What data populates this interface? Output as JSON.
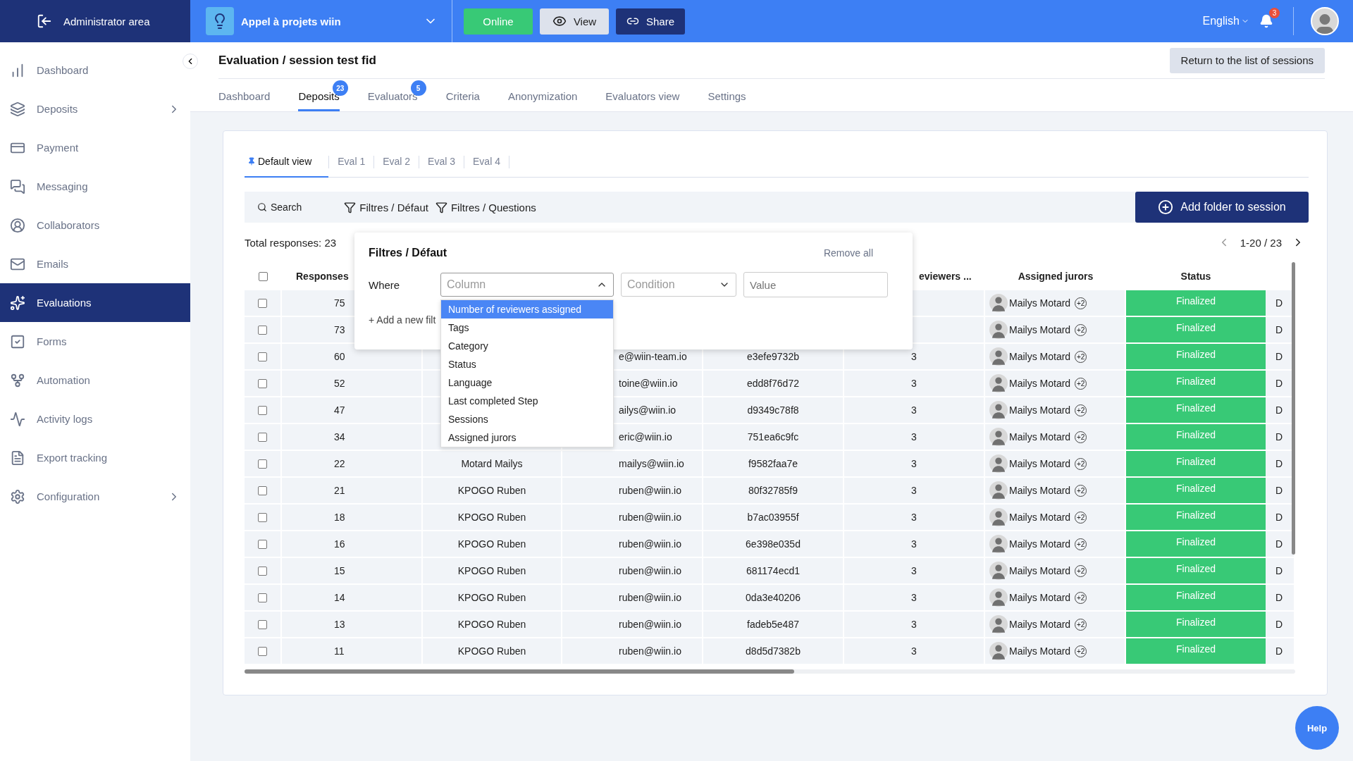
{
  "topbar": {
    "admin_label": "Administrator area",
    "project": "Appel à projets wiin",
    "online": "Online",
    "view": "View",
    "share": "Share",
    "language": "English",
    "notifications": "3"
  },
  "sidebar": {
    "items": [
      {
        "label": "Dashboard",
        "selected": false,
        "has_submenu": false
      },
      {
        "label": "Deposits",
        "selected": false,
        "has_submenu": true
      },
      {
        "label": "Payment",
        "selected": false,
        "has_submenu": false
      },
      {
        "label": "Messaging",
        "selected": false,
        "has_submenu": false
      },
      {
        "label": "Collaborators",
        "selected": false,
        "has_submenu": false
      },
      {
        "label": "Emails",
        "selected": false,
        "has_submenu": false
      },
      {
        "label": "Evaluations",
        "selected": true,
        "has_submenu": false
      },
      {
        "label": "Forms",
        "selected": false,
        "has_submenu": false
      },
      {
        "label": "Automation",
        "selected": false,
        "has_submenu": false
      },
      {
        "label": "Activity logs",
        "selected": false,
        "has_submenu": false
      },
      {
        "label": "Export tracking",
        "selected": false,
        "has_submenu": false
      },
      {
        "label": "Configuration",
        "selected": false,
        "has_submenu": true
      }
    ]
  },
  "header": {
    "title": "Evaluation / session test fid",
    "back_button": "Return to the list of sessions",
    "tabs": [
      {
        "label": "Dashboard",
        "selected": false
      },
      {
        "label": "Deposits",
        "selected": true,
        "badge": "23"
      },
      {
        "label": "Evaluators",
        "selected": false,
        "badge": "5"
      },
      {
        "label": "Criteria",
        "selected": false
      },
      {
        "label": "Anonymization",
        "selected": false
      },
      {
        "label": "Evaluators view",
        "selected": false
      },
      {
        "label": "Settings",
        "selected": false
      }
    ]
  },
  "view_tabs": [
    {
      "label": "Default view",
      "selected": true
    },
    {
      "label": "Eval 1",
      "selected": false
    },
    {
      "label": "Eval 2",
      "selected": false
    },
    {
      "label": "Eval 3",
      "selected": false
    },
    {
      "label": "Eval 4",
      "selected": false
    }
  ],
  "toolbar": {
    "search": "Search",
    "filters": [
      "Filtres / Défaut",
      "Filtres / Questions"
    ],
    "add_button": "Add folder to session"
  },
  "total": "Total responses: 23",
  "pagination": "1-20 / 23",
  "table": {
    "header_checked": false,
    "columns": [
      "Responses",
      null,
      null,
      null,
      "eviewers ...",
      "Assigned jurors",
      "Status",
      null
    ],
    "rows": [
      {
        "checked": false,
        "cells": [
          "75",
          null,
          null,
          null,
          null,
          "Mailys Motard",
          "Finalized",
          "D"
        ],
        "extra": "+2"
      },
      {
        "checked": false,
        "cells": [
          "73",
          null,
          null,
          null,
          null,
          "Mailys Motard",
          "Finalized",
          "D"
        ],
        "extra": "+2"
      },
      {
        "checked": false,
        "cells": [
          "60",
          null,
          "e@wiin-team.io",
          "e3efe9732b",
          "3",
          "Mailys Motard",
          "Finalized",
          "D"
        ],
        "extra": "+2"
      },
      {
        "checked": false,
        "cells": [
          "52",
          null,
          "toine@wiin.io",
          "edd8f76d72",
          "3",
          "Mailys Motard",
          "Finalized",
          "D"
        ],
        "extra": "+2"
      },
      {
        "checked": false,
        "cells": [
          "47",
          null,
          "ailys@wiin.io",
          "d9349c78f8",
          "3",
          "Mailys Motard",
          "Finalized",
          "D"
        ],
        "extra": "+2"
      },
      {
        "checked": false,
        "cells": [
          "34",
          null,
          "eric@wiin.io",
          "751ea6c9fc",
          "3",
          "Mailys Motard",
          "Finalized",
          "D"
        ],
        "extra": "+2"
      },
      {
        "checked": false,
        "cells": [
          "22",
          "Motard Mailys",
          "mailys@wiin.io",
          "f9582faa7e",
          "3",
          "Mailys Motard",
          "Finalized",
          "D"
        ],
        "extra": "+2"
      },
      {
        "checked": false,
        "cells": [
          "21",
          "KPOGO Ruben",
          "ruben@wiin.io",
          "80f32785f9",
          "3",
          "Mailys Motard",
          "Finalized",
          "D"
        ],
        "extra": "+2"
      },
      {
        "checked": false,
        "cells": [
          "18",
          "KPOGO Ruben",
          "ruben@wiin.io",
          "b7ac03955f",
          "3",
          "Mailys Motard",
          "Finalized",
          "D"
        ],
        "extra": "+2"
      },
      {
        "checked": false,
        "cells": [
          "16",
          "KPOGO Ruben",
          "ruben@wiin.io",
          "6e398e035d",
          "3",
          "Mailys Motard",
          "Finalized",
          "D"
        ],
        "extra": "+2"
      },
      {
        "checked": false,
        "cells": [
          "15",
          "KPOGO Ruben",
          "ruben@wiin.io",
          "681174ecd1",
          "3",
          "Mailys Motard",
          "Finalized",
          "D"
        ],
        "extra": "+2"
      },
      {
        "checked": false,
        "cells": [
          "14",
          "KPOGO Ruben",
          "ruben@wiin.io",
          "0da3e40206",
          "3",
          "Mailys Motard",
          "Finalized",
          "D"
        ],
        "extra": "+2"
      },
      {
        "checked": false,
        "cells": [
          "13",
          "KPOGO Ruben",
          "ruben@wiin.io",
          "fadeb5e487",
          "3",
          "Mailys Motard",
          "Finalized",
          "D"
        ],
        "extra": "+2"
      },
      {
        "checked": false,
        "cells": [
          "11",
          "KPOGO Ruben",
          "ruben@wiin.io",
          "d8d5d7382b",
          "3",
          "Mailys Motard",
          "Finalized",
          "D"
        ],
        "extra": "+2"
      }
    ]
  },
  "filter_popup": {
    "title": "Filtres / Défaut",
    "remove_all": "Remove all",
    "where": "Where",
    "column_select": {
      "placeholder": "Column",
      "expanded": true
    },
    "condition_select": {
      "placeholder": "Condition"
    },
    "value_field": {
      "placeholder": "Value"
    },
    "add_filter": "+ Add a new filt",
    "options": [
      {
        "label": "Number of reviewers assigned",
        "selected": true
      },
      {
        "label": "Tags",
        "selected": false
      },
      {
        "label": "Category",
        "selected": false
      },
      {
        "label": "Status",
        "selected": false
      },
      {
        "label": "Language",
        "selected": false
      },
      {
        "label": "Last completed Step",
        "selected": false
      },
      {
        "label": "Sessions",
        "selected": false
      },
      {
        "label": "Assigned jurors",
        "selected": false
      }
    ]
  },
  "help": "Help"
}
